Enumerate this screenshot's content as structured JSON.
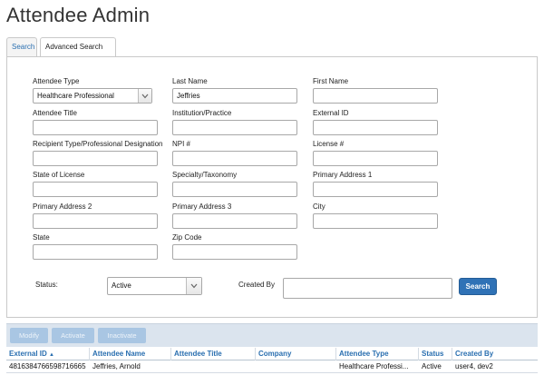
{
  "page": {
    "title": "Attendee Admin"
  },
  "tabs": [
    {
      "label": "Search",
      "active": false
    },
    {
      "label": "Advanced Search",
      "active": true
    }
  ],
  "form": {
    "attendee_type": {
      "label": "Attendee Type",
      "value": "Healthcare Professional"
    },
    "last_name": {
      "label": "Last Name",
      "value": "Jeffries"
    },
    "first_name": {
      "label": "First Name",
      "value": ""
    },
    "attendee_title": {
      "label": "Attendee Title",
      "value": ""
    },
    "institution": {
      "label": "Institution/Practice",
      "value": ""
    },
    "external_id": {
      "label": "External ID",
      "value": ""
    },
    "recipient_type": {
      "label": "Recipient Type/Professional Designation",
      "value": ""
    },
    "npi": {
      "label": "NPI #",
      "value": ""
    },
    "license": {
      "label": "License #",
      "value": ""
    },
    "state_of_license": {
      "label": "State of License",
      "value": ""
    },
    "specialty": {
      "label": "Specialty/Taxonomy",
      "value": ""
    },
    "primary_address_1": {
      "label": "Primary Address 1",
      "value": ""
    },
    "primary_address_2": {
      "label": "Primary Address 2",
      "value": ""
    },
    "primary_address_3": {
      "label": "Primary Address 3",
      "value": ""
    },
    "city": {
      "label": "City",
      "value": ""
    },
    "state": {
      "label": "State",
      "value": ""
    },
    "zip_code": {
      "label": "Zip Code",
      "value": ""
    },
    "status": {
      "label": "Status:",
      "value": "Active"
    },
    "created_by": {
      "label": "Created By",
      "value": ""
    },
    "search_button": "Search"
  },
  "toolbar": {
    "modify": "Modify",
    "activate": "Activate",
    "inactivate": "Inactivate"
  },
  "table": {
    "columns": [
      "External ID",
      "Attendee Name",
      "Attendee Title",
      "Company",
      "Attendee Type",
      "Status",
      "Created By"
    ],
    "sort_indicator": "▲",
    "rows": [
      [
        "4816384766598716665",
        "Jeffries, Arnold",
        "",
        "",
        "Healthcare Professi...",
        "Active",
        "user4, dev2"
      ]
    ]
  },
  "colors": {
    "accent": "#2f72b6",
    "link": "#2a6fb0",
    "toolbar_bg": "#dbe4ee",
    "disabled_button": "#a9c6e3"
  },
  "icons": {
    "select_arrow": "chevron-down-icon",
    "sort": "sort-ascending-icon"
  }
}
